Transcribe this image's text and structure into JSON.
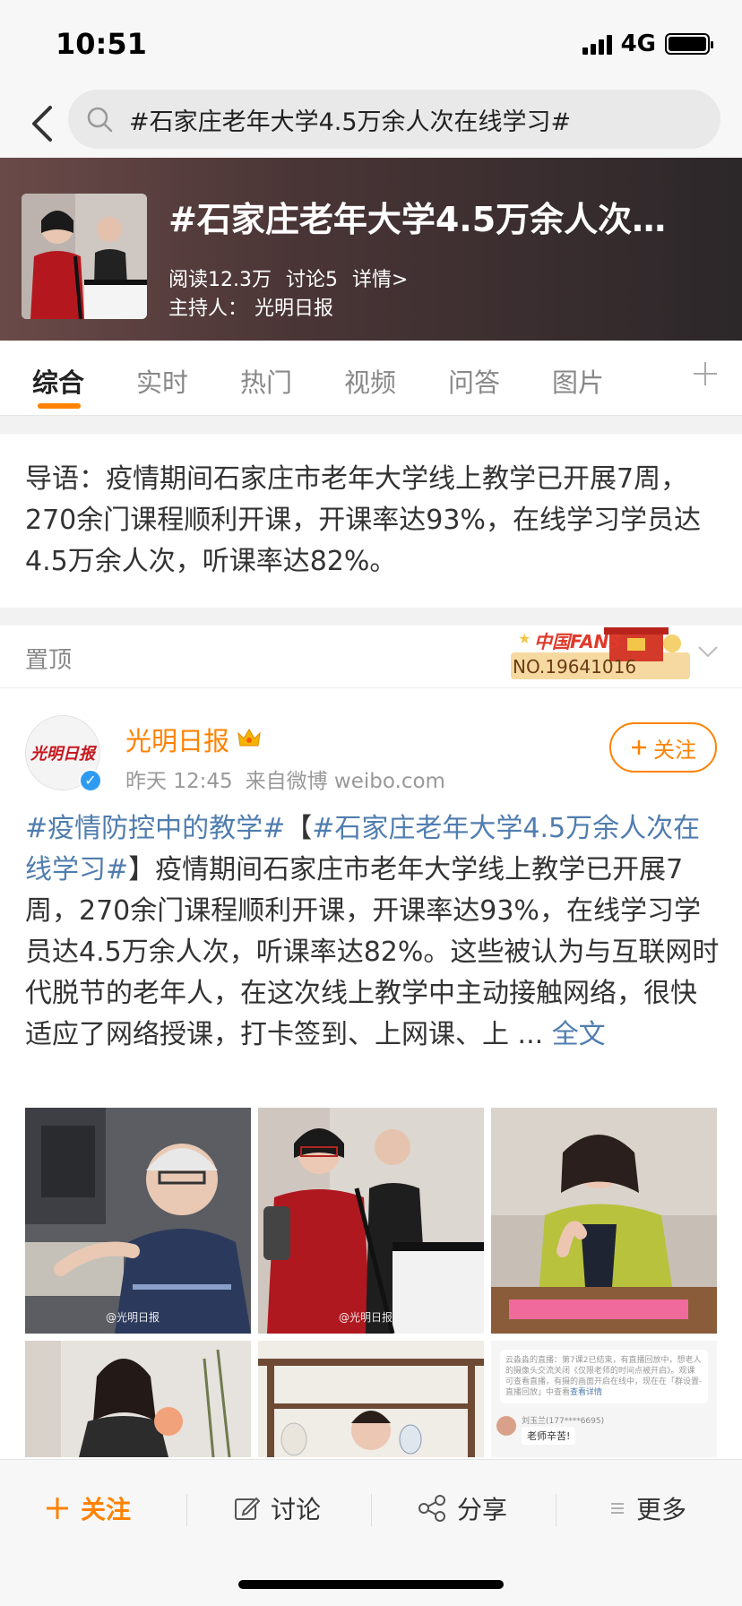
{
  "status": {
    "time": "10:51",
    "network": "4G"
  },
  "search": {
    "query": "#石家庄老年大学4.5万余人次在线学习#"
  },
  "topic": {
    "title": "#石家庄老年大学4.5万余人次…",
    "reads": "阅读12.3万",
    "discussions": "讨论5",
    "details": "详情>",
    "host_label": "主持人：",
    "host_name": "光明日报"
  },
  "tabs": [
    {
      "label": "综合",
      "active": true
    },
    {
      "label": "实时"
    },
    {
      "label": "热门"
    },
    {
      "label": "视频"
    },
    {
      "label": "问答"
    },
    {
      "label": "图片"
    }
  ],
  "intro": {
    "text": "导语：疫情期间石家庄市老年大学线上教学已开展7周，270余门课程顺利开课，开课率达93%，在线学习学员达4.5万余人次，听课率达82%。"
  },
  "pinned": {
    "label": "置顶",
    "badge_top": "中国FANS",
    "badge_bottom": "NO.19641016"
  },
  "post": {
    "author": "光明日报",
    "avatar_text": "光明日报",
    "time": "昨天 12:45",
    "source": "来自微博 weibo.com",
    "follow_label": "关注",
    "tag1": "#疫情防控中的教学#",
    "bracket_open": "【",
    "tag2": "#石家庄老年大学4.5万余人次在线学习#",
    "body": "】疫情期间石家庄市老年大学线上教学已开展7周，270余门课程顺利开课，开课率达93%，在线学习学员达4.5万余人次，听课率达82%。这些被认为与互联网时代脱节的老年人，在这次线上教学中主动接触网络，很快适应了网络授课，打卡签到、上网课、上 ... ",
    "full_text": "全文",
    "watermark": "@光明日报",
    "chat_screenshot": {
      "notice": "云淼淼的直播：第7课2已结束，有直播回放中，想老人的摄像头交流关闭《仅限老师的时间点被开启》。观课可查看直播，有摄的画面开启在线中，现在在「群设置-直播回放」中查看",
      "notice_link": "查看详情",
      "commenter": "刘玉兰(177****6695)",
      "comment": "老师辛苦!"
    }
  },
  "bottom_bar": {
    "follow": "关注",
    "discuss": "讨论",
    "share": "分享",
    "more": "更多"
  },
  "colors": {
    "accent": "#ff8200",
    "link": "#507daf"
  }
}
